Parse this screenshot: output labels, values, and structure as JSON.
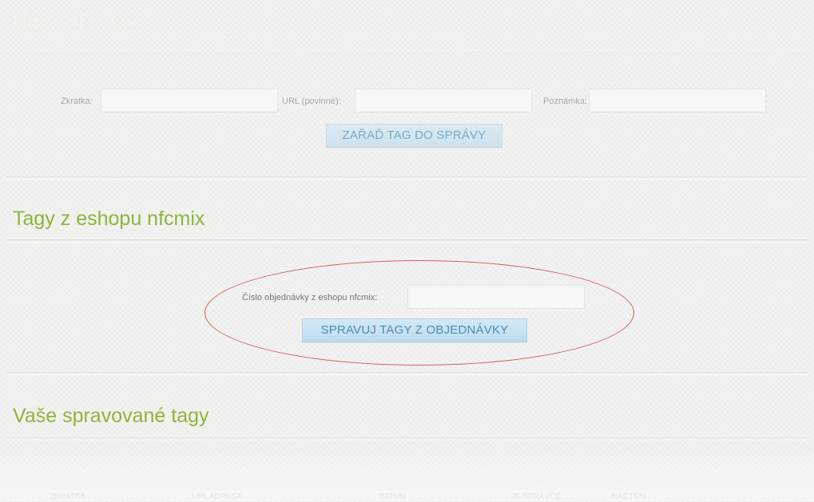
{
  "new_tag": {
    "title": "Nový NFC tag",
    "shortcut_label": "Zkratka:",
    "url_label": "URL (povinné):",
    "note_label": "Poznámka:",
    "shortcut_value": "",
    "url_value": "",
    "note_value": "",
    "add_button": "ZAŘAĎ TAG DO SPRÁVY"
  },
  "eshop_tags": {
    "title": "Tagy z eshopu nfcmix",
    "order_label": "Číslo objednávky z eshopu nfcmix:",
    "order_value": "",
    "manage_button": "SPRAVUJ TAGY Z OBJEDNÁVKY"
  },
  "managed_tags": {
    "title": "Vaše spravované tagy",
    "columns": [
      "ZKRATKA",
      "URL ADRESA",
      "DATUM",
      "JE SPRÁVCE",
      "NAČTENÍ"
    ]
  },
  "colors": {
    "section_title": "#8cb63a",
    "button_bg": "#cde5f4",
    "button_text": "#4a8cb6",
    "highlight_ellipse": "#d25b5b"
  }
}
